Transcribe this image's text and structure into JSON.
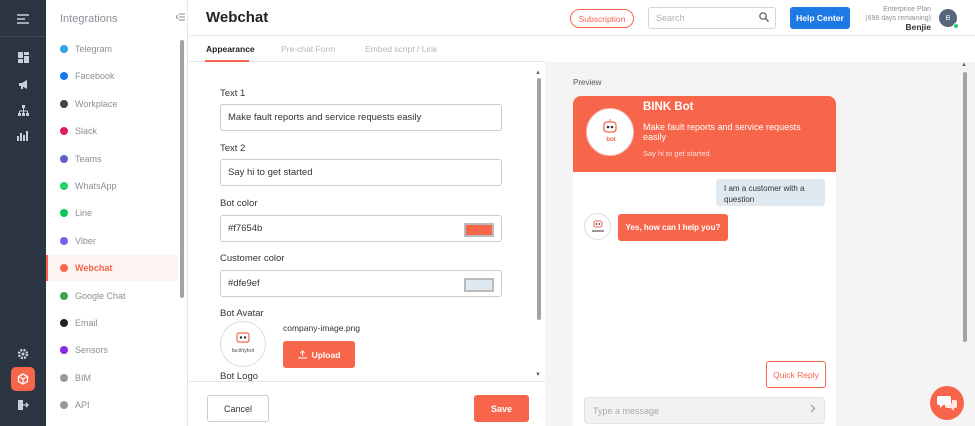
{
  "sidebar": {
    "title": "Integrations",
    "items": [
      {
        "label": "Telegram",
        "color": "#2ca5e0"
      },
      {
        "label": "Facebook",
        "color": "#1877f2"
      },
      {
        "label": "Workplace",
        "color": "#444444"
      },
      {
        "label": "Slack",
        "color": "#e01e5a"
      },
      {
        "label": "Teams",
        "color": "#5b5fc7"
      },
      {
        "label": "WhatsApp",
        "color": "#25d366"
      },
      {
        "label": "Line",
        "color": "#06c755"
      },
      {
        "label": "Viber",
        "color": "#7360f2"
      },
      {
        "label": "Webchat",
        "color": "#f7654b"
      },
      {
        "label": "Google Chat",
        "color": "#34a853"
      },
      {
        "label": "Email",
        "color": "#222222"
      },
      {
        "label": "Sensors",
        "color": "#8a2be2"
      },
      {
        "label": "BIM",
        "color": "#999999"
      },
      {
        "label": "API",
        "color": "#999999"
      }
    ],
    "active_index": 8
  },
  "header": {
    "title": "Webchat",
    "subscription_label": "Subscription",
    "search_placeholder": "Search",
    "help_label": "Help Center",
    "plan_name": "Enterprise Plan",
    "plan_days": "(698 days remaining)",
    "user_name": "Benjie",
    "avatar_initial": "B"
  },
  "tabs": [
    {
      "label": "Appearance",
      "active": true
    },
    {
      "label": "Pre-chat Form",
      "active": false
    },
    {
      "label": "Embed script / Link",
      "active": false
    }
  ],
  "form": {
    "text1_label": "Text 1",
    "text1_value": "Make fault reports and service requests easily",
    "text2_label": "Text 2",
    "text2_value": "Say hi to get started",
    "bot_color_label": "Bot color",
    "bot_color_value": "#f7654b",
    "customer_color_label": "Customer color",
    "customer_color_value": "#dfe9ef",
    "bot_avatar_label": "Bot Avatar",
    "avatar_file": "company-image.png",
    "upload_label": "Upload",
    "bot_logo_label": "Bot Logo",
    "cancel_label": "Cancel",
    "save_label": "Save"
  },
  "preview": {
    "label": "Preview",
    "bot_name": "BINK Bot",
    "logo_text": "bot",
    "avatar_logo_text": "facilitybot",
    "text1": "Make fault reports and service requests easily",
    "text2": "Say hi to get started",
    "customer_message": "I am a customer with a question",
    "bot_message": "Yes, how can I help you?",
    "quick_reply_label": "Quick Reply",
    "message_placeholder": "Type a message"
  },
  "colors": {
    "accent": "#f7654b",
    "rail": "#2b3542",
    "help_blue": "#1d7ae4"
  }
}
